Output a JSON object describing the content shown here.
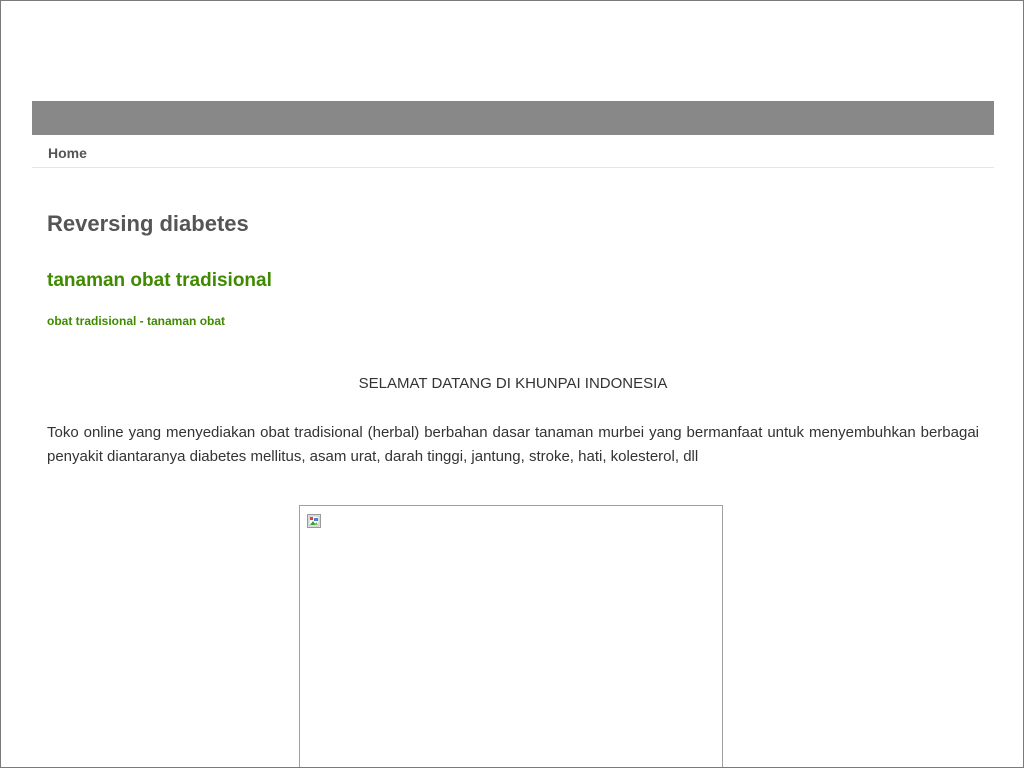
{
  "nav": {
    "items": [
      {
        "label": "Home"
      }
    ]
  },
  "site": {
    "title": "Reversing diabetes"
  },
  "post": {
    "title": "tanaman obat tradisional",
    "breadcrumb": "obat tradisional - tanaman obat",
    "welcome": "SELAMAT DATANG DI KHUNPAI INDONESIA",
    "intro": "Toko online yang menyediakan obat tradisional (herbal) berbahan dasar tanaman murbei yang bermanfaat untuk menyembuhkan berbagai penyakit diantaranya diabetes mellitus, asam urat, darah tinggi, jantung, stroke, hati, kolesterol, dll"
  },
  "image": {
    "icon": "broken-image-icon"
  },
  "colors": {
    "header_bar": "#888888",
    "link_green": "#3f8a00",
    "title_gray": "#555555"
  }
}
